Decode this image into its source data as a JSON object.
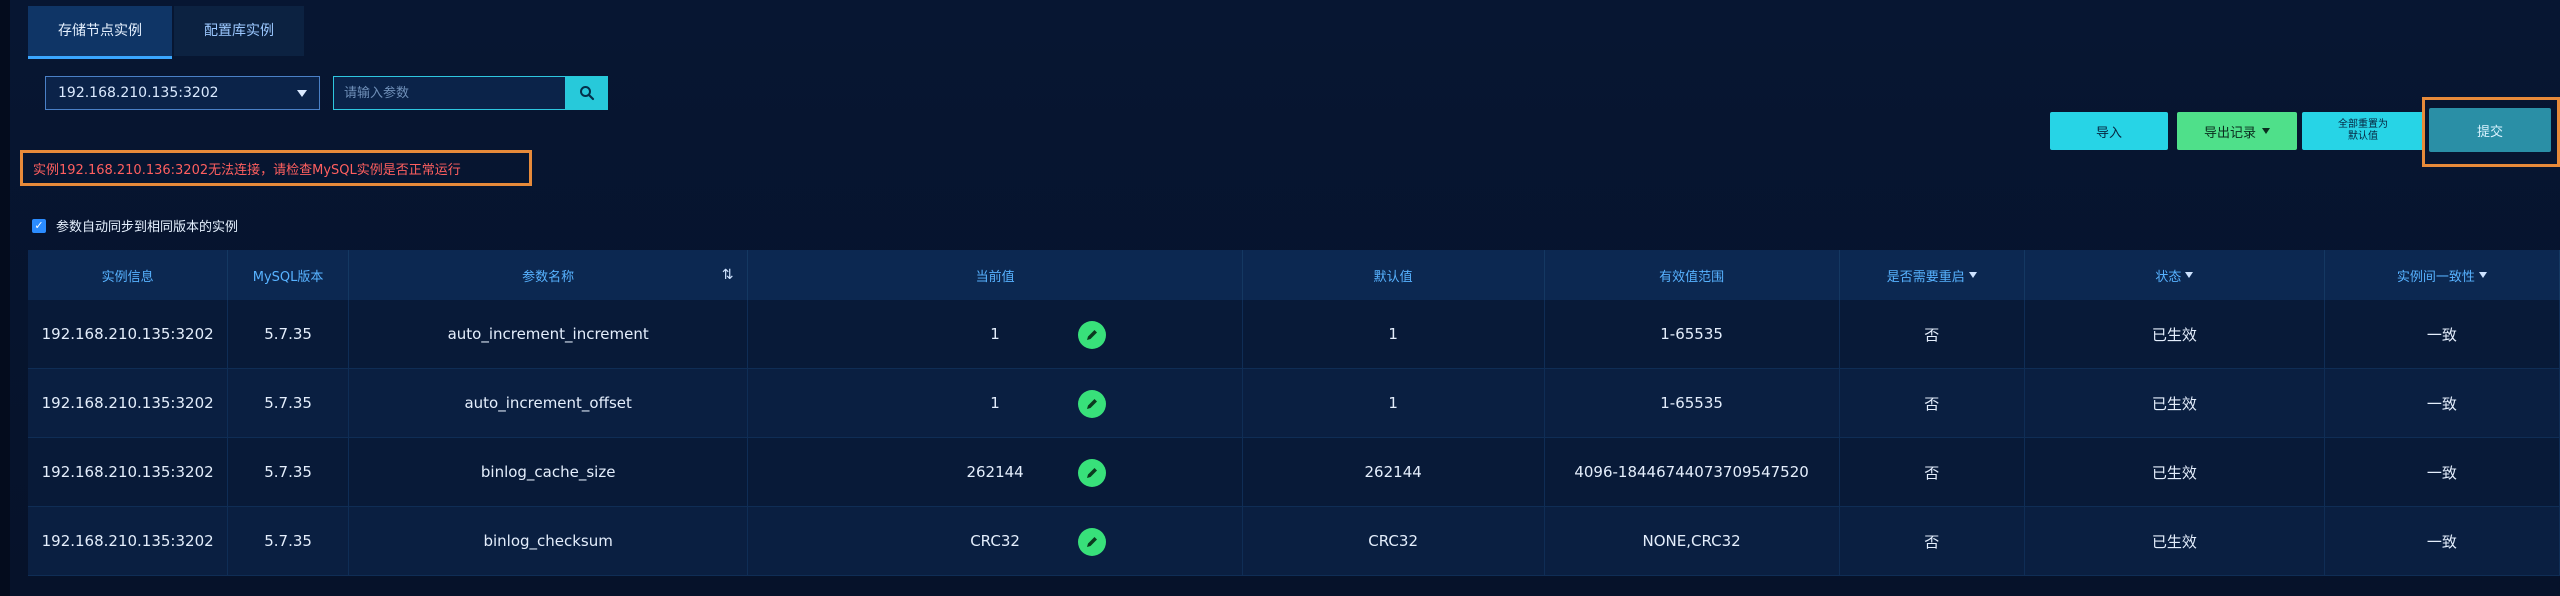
{
  "tabs": [
    "存储节点实例",
    "配置库实例"
  ],
  "instance_select": {
    "value": "192.168.210.135:3202"
  },
  "search": {
    "placeholder": "请输入参数",
    "icon": "search-icon"
  },
  "error_message": "实例192.168.210.136:3202无法连接，请检查MySQL实例是否正常运行",
  "actions": {
    "import_label": "导入",
    "export_label": "导出记录",
    "reset_label_line1": "全部重置为",
    "reset_label_line2": "默认值",
    "submit_label": "提交"
  },
  "sync_checkbox_label": "参数自动同步到相同版本的实例",
  "table": {
    "headers": [
      "实例信息",
      "MySQL版本",
      "参数名称",
      "当前值",
      "默认值",
      "有效值范围",
      "是否需要重启",
      "状态",
      "实例间一致性"
    ],
    "rows": [
      [
        "192.168.210.135:3202",
        "5.7.35",
        "auto_increment_increment",
        "1",
        "1",
        "1-65535",
        "否",
        "已生效",
        "一致"
      ],
      [
        "192.168.210.135:3202",
        "5.7.35",
        "auto_increment_offset",
        "1",
        "1",
        "1-65535",
        "否",
        "已生效",
        "一致"
      ],
      [
        "192.168.210.135:3202",
        "5.7.35",
        "binlog_cache_size",
        "262144",
        "262144",
        "4096-18446744073709547520",
        "否",
        "已生效",
        "一致"
      ],
      [
        "192.168.210.135:3202",
        "5.7.35",
        "binlog_checksum",
        "CRC32",
        "CRC32",
        "NONE,CRC32",
        "否",
        "已生效",
        "一致"
      ]
    ]
  },
  "colors": {
    "accent_cyan": "#27d4e6",
    "accent_green": "#4fe08a",
    "error_red": "#ff5f5f",
    "highlight_orange": "#e78a3a"
  }
}
